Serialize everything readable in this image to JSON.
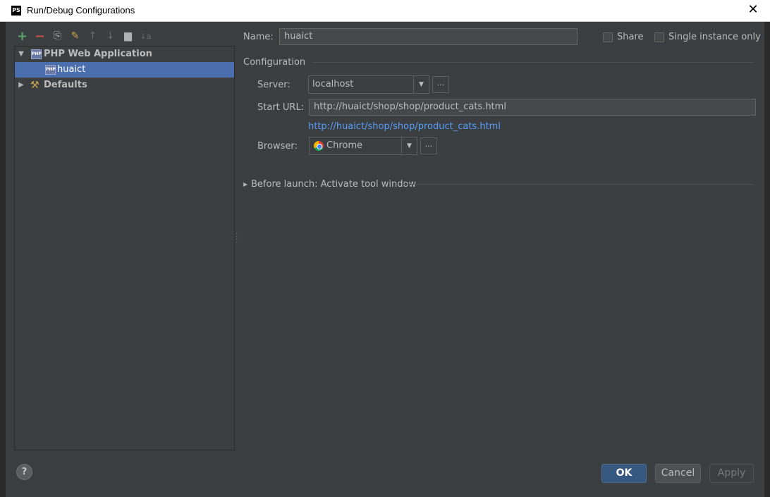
{
  "window": {
    "title": "Run/Debug Configurations",
    "app_icon": "PS"
  },
  "toolbar": {
    "add": "+",
    "remove": "−",
    "copy": "⎘",
    "edit_defaults": "✎",
    "move_up": "↑",
    "move_down": "↓",
    "folder": "▆",
    "sort": "↓a"
  },
  "tree": {
    "items": [
      {
        "label": "PHP Web Application",
        "icon": "php-icon",
        "expanded": true
      },
      {
        "label": "huaict",
        "icon": "php-icon",
        "selected": true
      },
      {
        "label": "Defaults",
        "icon": "wrench-icon",
        "expanded": false
      }
    ]
  },
  "form": {
    "name_label": "Name:",
    "name_value": "huaict",
    "share_label": "Share",
    "single_instance_label": "Single instance only",
    "configuration_label": "Configuration",
    "server_label": "Server:",
    "server_value": "localhost",
    "start_url_label": "Start URL:",
    "start_url_value": "http://huaict/shop/shop/product_cats.html",
    "start_url_link": "http://huaict/shop/shop/product_cats.html",
    "browser_label": "Browser:",
    "browser_value": "Chrome",
    "dots": "...",
    "before_launch": "Before launch: Activate tool window"
  },
  "buttons": {
    "ok": "OK",
    "cancel": "Cancel",
    "apply": "Apply",
    "help": "?"
  }
}
